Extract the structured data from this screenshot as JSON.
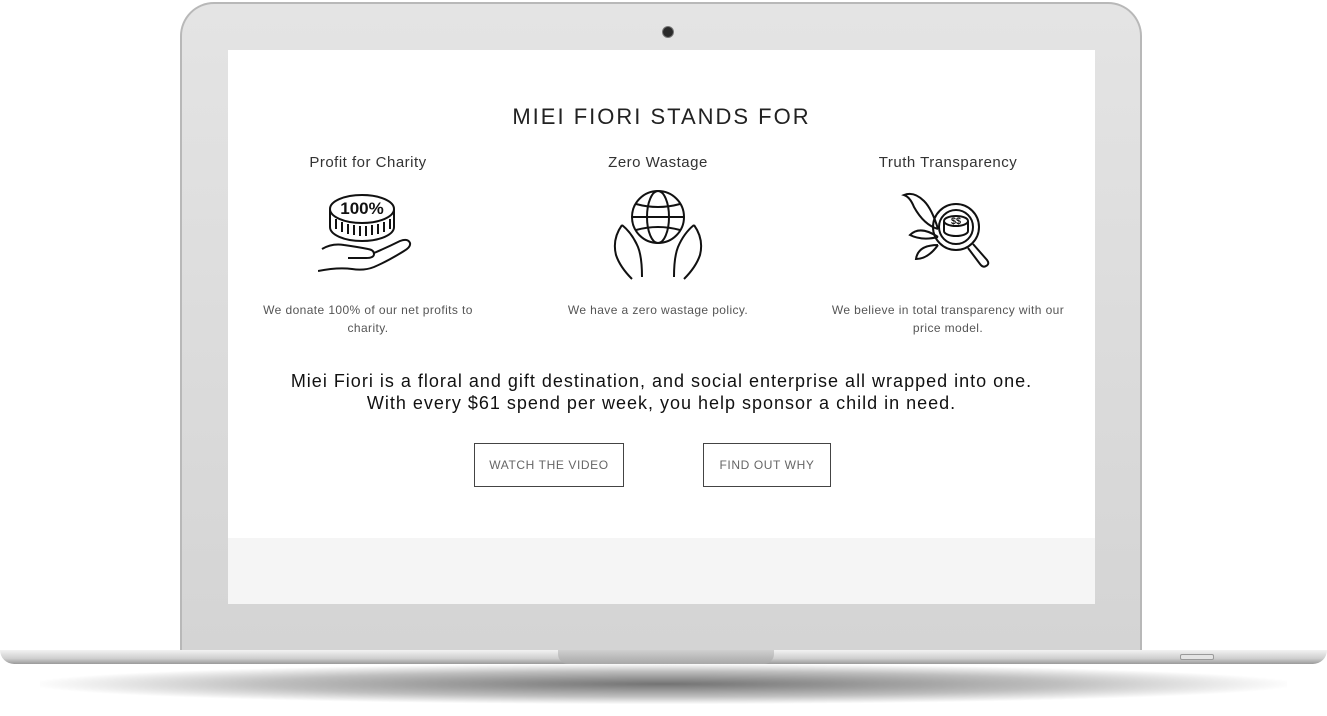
{
  "section": {
    "title": "MIEI FIORI STANDS FOR"
  },
  "features": [
    {
      "title": "Profit for Charity",
      "icon": "coin-hand-icon",
      "coin_text": "100%",
      "description": "We donate 100% of our net profits to charity."
    },
    {
      "title": "Zero Wastage",
      "icon": "globe-hands-icon",
      "description": "We have a zero wastage policy."
    },
    {
      "title": "Truth Transparency",
      "icon": "magnifier-coin-icon",
      "description": "We believe in total transparency with our price model."
    }
  ],
  "tagline": {
    "line1": "Miei Fiori is a floral and gift destination, and social enterprise all wrapped into one.",
    "line2": "With every $61 spend per week, you help sponsor a child in need."
  },
  "buttons": {
    "watch_video": "WATCH THE VIDEO",
    "find_out_why": "FIND OUT WHY"
  },
  "colors": {
    "text_dark": "#222222",
    "text_muted": "#555555",
    "button_border": "#444444"
  }
}
